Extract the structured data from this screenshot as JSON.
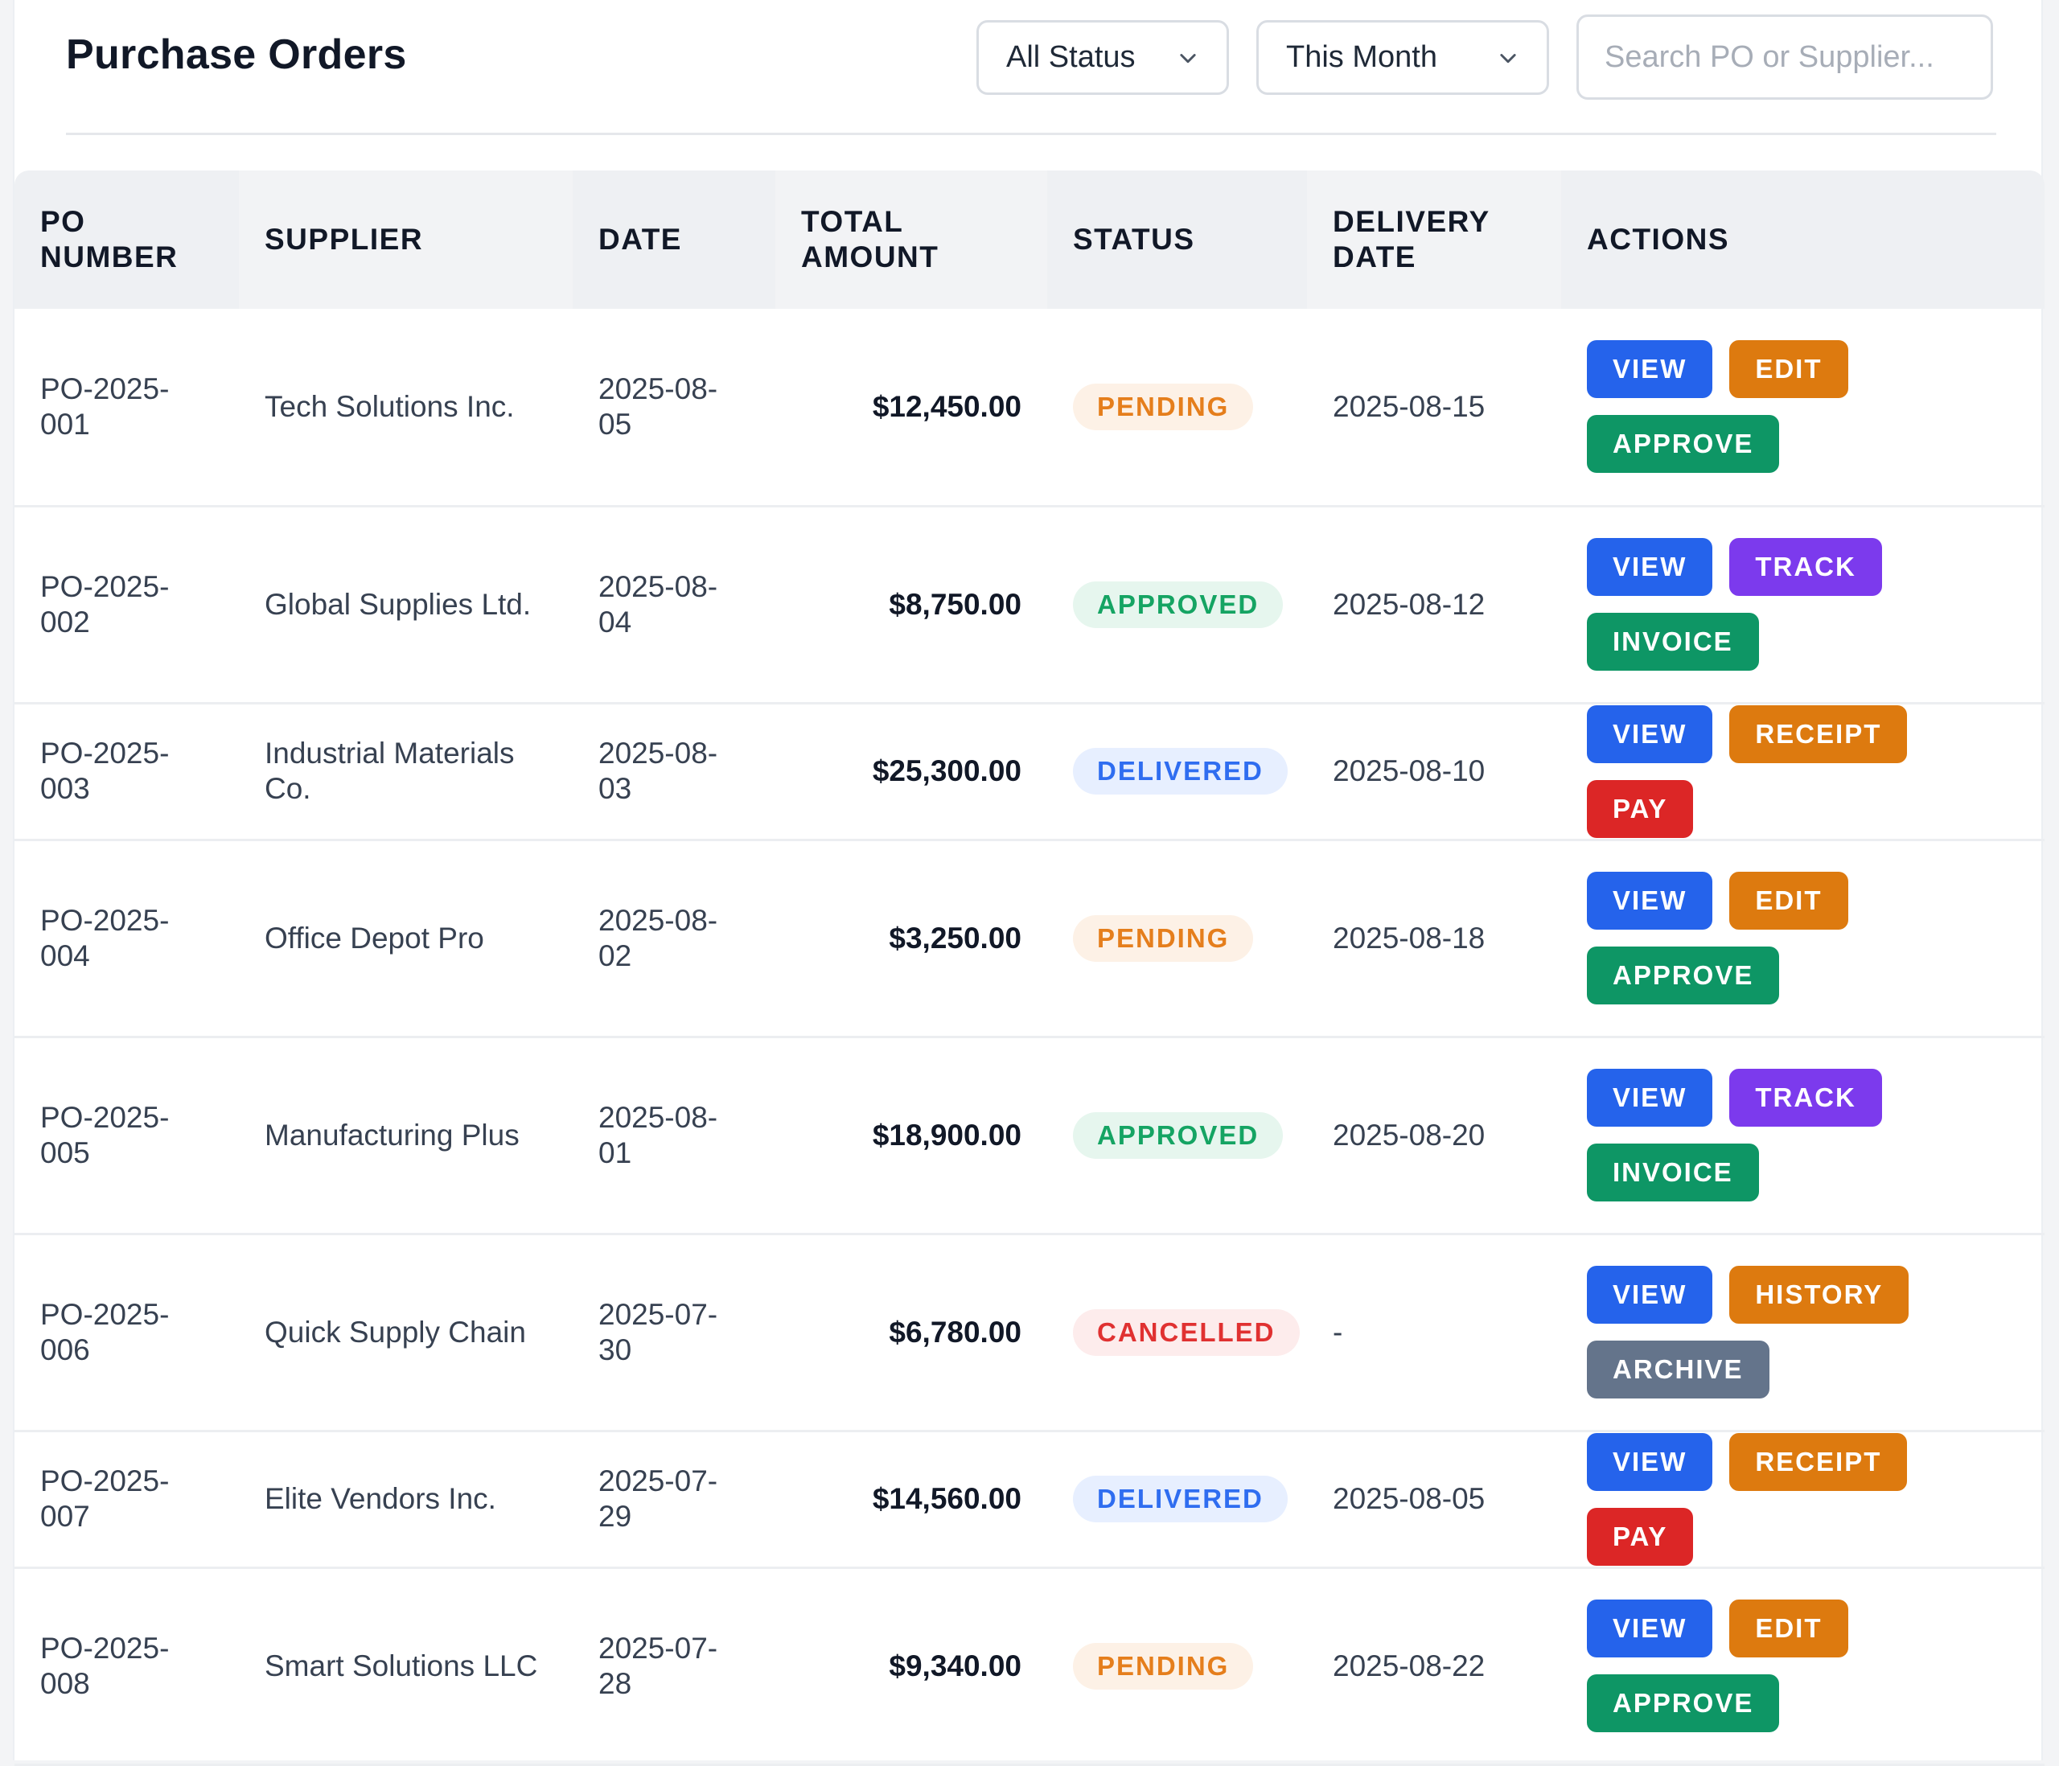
{
  "header": {
    "title": "Purchase Orders",
    "status_filter": "All Status",
    "period_filter": "This Month",
    "search_placeholder": "Search PO or Supplier..."
  },
  "table": {
    "columns": [
      "PO NUMBER",
      "SUPPLIER",
      "DATE",
      "TOTAL AMOUNT",
      "STATUS",
      "DELIVERY DATE",
      "ACTIONS"
    ],
    "rows": [
      {
        "po": "PO-2025-001",
        "supplier": "Tech Solutions Inc.",
        "date": "2025-08-05",
        "amount": "$12,450.00",
        "status": "PENDING",
        "status_kind": "pending",
        "delivery": "2025-08-15",
        "actions": [
          "VIEW",
          "EDIT",
          "APPROVE"
        ]
      },
      {
        "po": "PO-2025-002",
        "supplier": "Global Supplies Ltd.",
        "date": "2025-08-04",
        "amount": "$8,750.00",
        "status": "APPROVED",
        "status_kind": "approved",
        "delivery": "2025-08-12",
        "actions": [
          "VIEW",
          "TRACK",
          "INVOICE"
        ]
      },
      {
        "po": "PO-2025-003",
        "supplier": "Industrial Materials Co.",
        "date": "2025-08-03",
        "amount": "$25,300.00",
        "status": "DELIVERED",
        "status_kind": "delivered",
        "delivery": "2025-08-10",
        "actions": [
          "VIEW",
          "RECEIPT",
          "PAY"
        ]
      },
      {
        "po": "PO-2025-004",
        "supplier": "Office Depot Pro",
        "date": "2025-08-02",
        "amount": "$3,250.00",
        "status": "PENDING",
        "status_kind": "pending",
        "delivery": "2025-08-18",
        "actions": [
          "VIEW",
          "EDIT",
          "APPROVE"
        ]
      },
      {
        "po": "PO-2025-005",
        "supplier": "Manufacturing Plus",
        "date": "2025-08-01",
        "amount": "$18,900.00",
        "status": "APPROVED",
        "status_kind": "approved",
        "delivery": "2025-08-20",
        "actions": [
          "VIEW",
          "TRACK",
          "INVOICE"
        ]
      },
      {
        "po": "PO-2025-006",
        "supplier": "Quick Supply Chain",
        "date": "2025-07-30",
        "amount": "$6,780.00",
        "status": "CANCELLED",
        "status_kind": "cancelled",
        "delivery": "-",
        "actions": [
          "VIEW",
          "HISTORY",
          "ARCHIVE"
        ]
      },
      {
        "po": "PO-2025-007",
        "supplier": "Elite Vendors Inc.",
        "date": "2025-07-29",
        "amount": "$14,560.00",
        "status": "DELIVERED",
        "status_kind": "delivered",
        "delivery": "2025-08-05",
        "actions": [
          "VIEW",
          "RECEIPT",
          "PAY"
        ]
      },
      {
        "po": "PO-2025-008",
        "supplier": "Smart Solutions LLC",
        "date": "2025-07-28",
        "amount": "$9,340.00",
        "status": "PENDING",
        "status_kind": "pending",
        "delivery": "2025-08-22",
        "actions": [
          "VIEW",
          "EDIT",
          "APPROVE"
        ]
      }
    ]
  },
  "colors": {
    "view": "#2563eb",
    "edit": "#dd7a0f",
    "approve": "#0e9665",
    "track": "#7c3aed",
    "invoice": "#0e9665",
    "receipt": "#dd7a0f",
    "pay": "#dc2626",
    "history": "#dd7a0f",
    "archive": "#64748b",
    "pending": "#e57e1c",
    "approved": "#15a463",
    "delivered": "#2f6df0",
    "cancelled": "#e03131"
  },
  "icons": {
    "dropdown": "chevron-down-icon"
  }
}
